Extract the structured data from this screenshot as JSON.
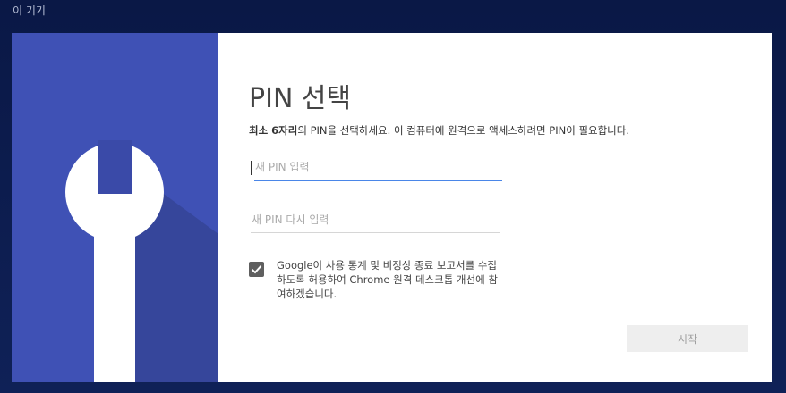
{
  "header": {
    "title": "이 기기"
  },
  "dialog": {
    "icon": "wrench-icon",
    "title": "PIN 선택",
    "description_bold": "최소 6자리",
    "description_rest": "의 PIN을 선택하세요. 이 컴퓨터에 원격으로 액세스하려면 PIN이 필요합니다.",
    "pin_input": {
      "value": "",
      "placeholder": "새 PIN 입력"
    },
    "pin_confirm_input": {
      "value": "",
      "placeholder": "새 PIN 다시 입력"
    },
    "consent": {
      "checked": true,
      "label": "Google이 사용 통계 및 비정상 종료 보고서를 수집하도록 허용하여 Chrome 원격 데스크톱 개선에 참여하겠습니다."
    },
    "start_button_label": "시작"
  },
  "colors": {
    "background": "#0d1b4c",
    "left_panel": "#3f51b5",
    "accent": "#4a86e8",
    "checkbox": "#5f5f5f",
    "button_disabled_bg": "#eeeeee"
  }
}
